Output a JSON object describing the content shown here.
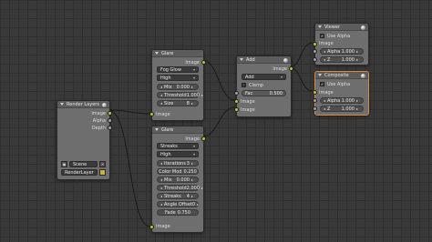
{
  "render_layers": {
    "title": "Render Layers",
    "outputs": [
      "Image",
      "Alpha",
      "Depth"
    ],
    "scene": "Scene",
    "layer": "RenderLayer",
    "close_x": "✕"
  },
  "glare": {
    "title": "Glare",
    "out": "Image",
    "type": "Fog Glow",
    "quality": "High",
    "mix_label": "Mix",
    "mix_value": "0.000",
    "threshold_label": "Threshold",
    "threshold_value": "1.000",
    "size_label": "Size",
    "size_value": "8",
    "in": "Image"
  },
  "glare2": {
    "title": "Glare",
    "out": "Image",
    "type": "Streaks",
    "quality": "High",
    "iterations_label": "Iterations",
    "iterations_value": "3",
    "color_mod_label": "Color Mod",
    "color_mod_value": "0.250",
    "mix_label": "Mix",
    "mix_value": "0.000",
    "threshold_label": "Threshold",
    "threshold_value": "2.000",
    "streaks_label": "Streaks",
    "streaks_value": "4",
    "angle_label": "Angle Offset",
    "angle_value": "0",
    "fade_label": "Fade",
    "fade_value": "0.750",
    "in": "Image"
  },
  "add": {
    "title": "Add",
    "out": "Image",
    "blend": "Add",
    "clamp": "Clamp",
    "fac_label": "Fac",
    "fac_value": "0.500",
    "in1": "Image",
    "in2": "Image"
  },
  "viewer": {
    "title": "Viewer",
    "use_alpha": "Use Alpha",
    "image": "Image",
    "alpha_label": "Alpha",
    "alpha_value": "1.000",
    "z_label": "Z",
    "z_value": "1.000"
  },
  "composite": {
    "title": "Composite",
    "use_alpha": "Use Alpha",
    "image": "Image",
    "alpha_label": "Alpha",
    "alpha_value": "1.000",
    "z_label": "Z",
    "z_value": "1.000"
  }
}
